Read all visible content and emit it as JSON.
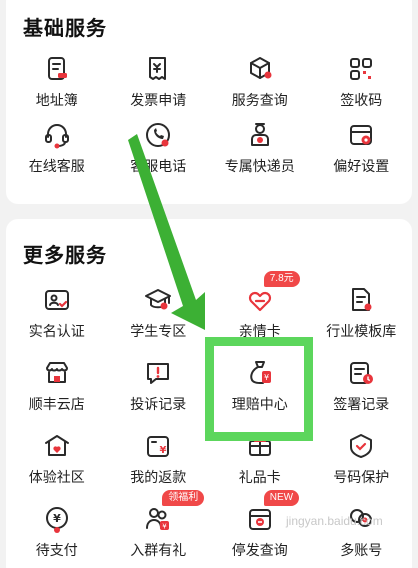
{
  "basic": {
    "title": "基础服务",
    "items": [
      {
        "label": "地址簿",
        "icon": "address-book-icon"
      },
      {
        "label": "发票申请",
        "icon": "invoice-icon"
      },
      {
        "label": "服务查询",
        "icon": "service-query-icon"
      },
      {
        "label": "签收码",
        "icon": "qr-code-icon"
      },
      {
        "label": "在线客服",
        "icon": "headset-icon"
      },
      {
        "label": "客服电话",
        "icon": "phone-icon"
      },
      {
        "label": "专属快递员",
        "icon": "courier-icon"
      },
      {
        "label": "偏好设置",
        "icon": "settings-icon"
      }
    ]
  },
  "more": {
    "title": "更多服务",
    "items": [
      {
        "label": "实名认证",
        "icon": "id-card-icon",
        "badge": ""
      },
      {
        "label": "学生专区",
        "icon": "graduation-cap-icon",
        "badge": ""
      },
      {
        "label": "亲情卡",
        "icon": "family-card-icon",
        "badge": "7.8元"
      },
      {
        "label": "行业模板库",
        "icon": "template-icon",
        "badge": ""
      },
      {
        "label": "顺丰云店",
        "icon": "store-icon",
        "badge": ""
      },
      {
        "label": "投诉记录",
        "icon": "complaint-icon",
        "badge": ""
      },
      {
        "label": "理赔中心",
        "icon": "claims-bag-icon",
        "badge": ""
      },
      {
        "label": "签署记录",
        "icon": "sign-record-icon",
        "badge": ""
      },
      {
        "label": "体验社区",
        "icon": "community-icon",
        "badge": ""
      },
      {
        "label": "我的返款",
        "icon": "refund-icon",
        "badge": ""
      },
      {
        "label": "礼品卡",
        "icon": "gift-card-icon",
        "badge": ""
      },
      {
        "label": "号码保护",
        "icon": "privacy-number-icon",
        "badge": ""
      },
      {
        "label": "待支付",
        "icon": "payment-icon",
        "badge": ""
      },
      {
        "label": "入群有礼",
        "icon": "group-gift-icon",
        "badge": "领福利"
      },
      {
        "label": "停发查询",
        "icon": "suspend-query-icon",
        "badge": "NEW"
      },
      {
        "label": "多账号",
        "icon": "multi-account-icon",
        "badge": ""
      }
    ]
  },
  "colors": {
    "accent": "#e8353c",
    "highlight": "#5cd65c",
    "arrow": "#3cb034"
  },
  "watermark": "jingyan.baidu.com"
}
